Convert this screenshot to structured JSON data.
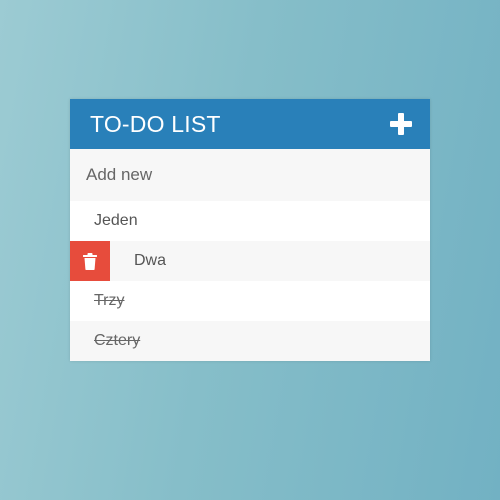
{
  "header": {
    "title": "TO-DO LIST",
    "add_icon": "plus-icon"
  },
  "input": {
    "placeholder": "Add new",
    "value": ""
  },
  "items": [
    {
      "label": "Jeden",
      "completed": false,
      "hovered": false
    },
    {
      "label": "Dwa",
      "completed": false,
      "hovered": true,
      "action_icon": "trash-icon"
    },
    {
      "label": "Trzy",
      "completed": true,
      "hovered": false
    },
    {
      "label": "Cztery",
      "completed": true,
      "hovered": false
    }
  ],
  "colors": {
    "header": "#2980b9",
    "delete": "#e74c3c",
    "row_alt": "#f7f7f7"
  }
}
